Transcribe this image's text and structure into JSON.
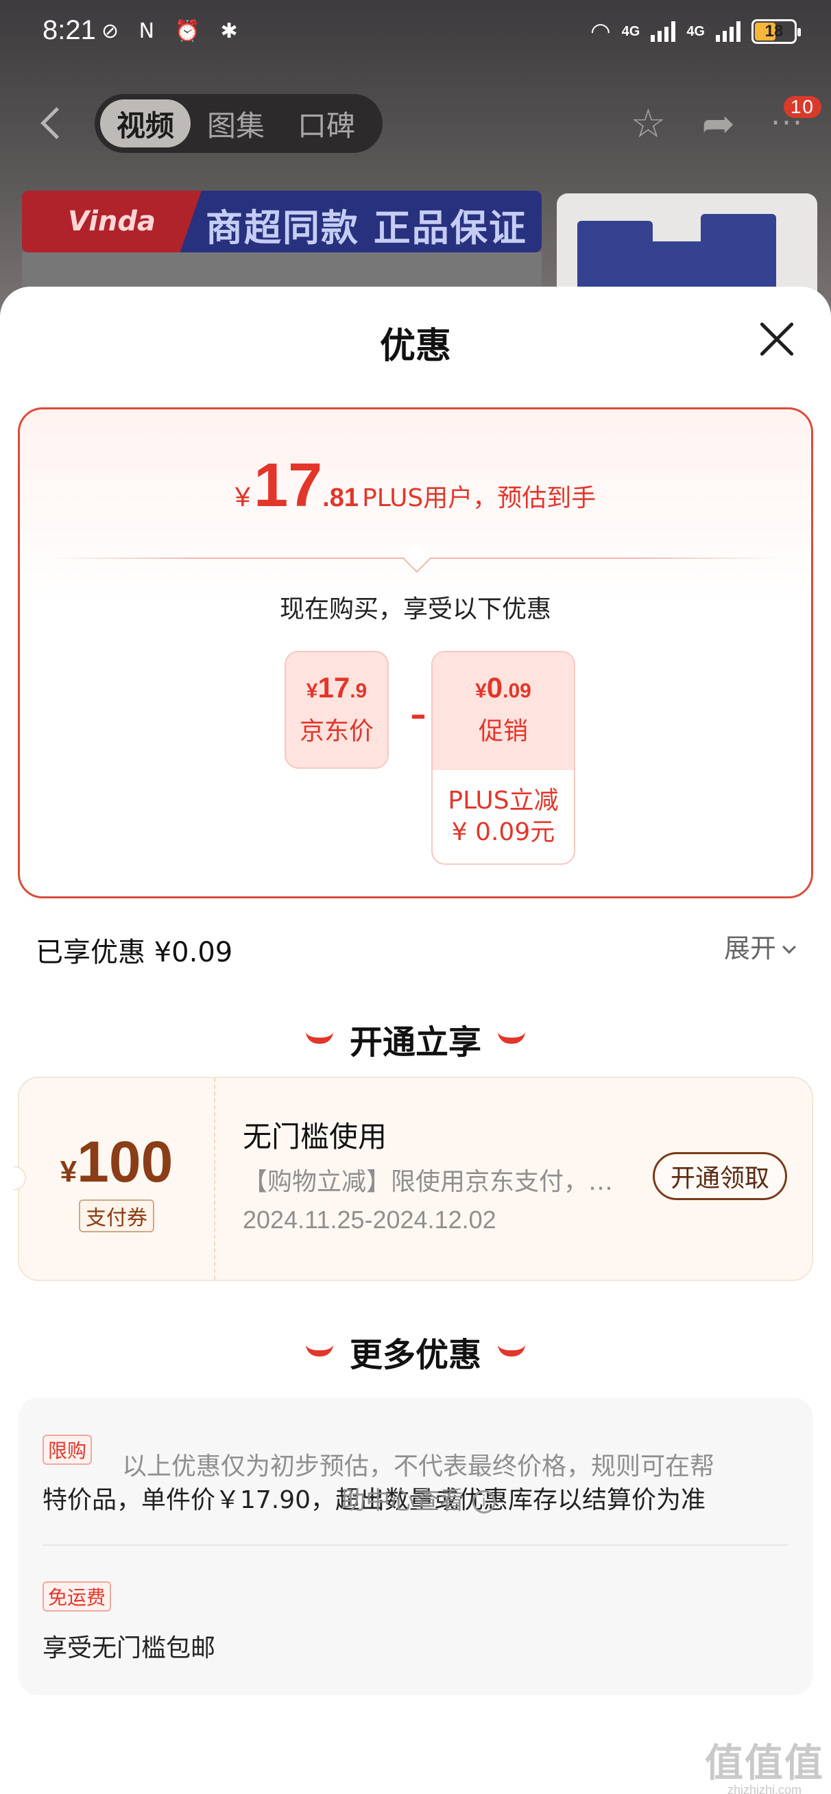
{
  "status_bar": {
    "time": "8:21",
    "left_icons": "⊘ N ⏰ ✱",
    "network_1": "4G",
    "network_2": "4G",
    "battery": "18"
  },
  "nav": {
    "tabs": [
      {
        "label": "视频",
        "active": true
      },
      {
        "label": "图集",
        "active": false
      },
      {
        "label": "口碑",
        "active": false
      }
    ],
    "more_badge": "10"
  },
  "background": {
    "brand": "Vinda",
    "banner_text": "商超同款 正品保证"
  },
  "sheet": {
    "title": "优惠",
    "estimate": {
      "currency": "¥",
      "price_int": "17",
      "price_dec": ".81",
      "label": "PLUS用户，预估到手"
    },
    "buy_now_text": "现在购买，享受以下优惠",
    "jd_price": {
      "currency": "¥",
      "int": "17",
      "dec": ".9",
      "label": "京东价"
    },
    "minus": "–",
    "promo": {
      "currency": "¥",
      "int": "0",
      "dec": ".09",
      "label": "促销",
      "detail_line1": "PLUS立减",
      "detail_line2": "¥ 0.09元"
    },
    "enjoyed": "已享优惠 ¥0.09",
    "expand_label": "展开"
  },
  "membership_section": {
    "heading": "开通立享",
    "coupon": {
      "currency": "¥",
      "amount": "100",
      "type": "支付券",
      "title": "无门槛使用",
      "desc": "【购物立减】限使用京东支付，…",
      "date_range": "2024.11.25-2024.12.02",
      "button": "开通领取"
    }
  },
  "more_section": {
    "heading": "更多优惠",
    "items": [
      {
        "tag": "限购",
        "text": "特价品，单件价￥17.90，超出数量或优惠库存以结算价为准"
      },
      {
        "tag": "免运费",
        "text": "享受无门槛包邮"
      }
    ]
  },
  "footnote": {
    "line1": "以上优惠仅为初步预估，不代表最终价格，规则可在帮",
    "line2": "助中心查看"
  },
  "watermark": {
    "logo": "值值值",
    "url": "zhizhizhi.com"
  },
  "colors": {
    "accent": "#e2362a",
    "coupon_brown": "#8a3d16",
    "card_border": "#dc4b3b"
  }
}
